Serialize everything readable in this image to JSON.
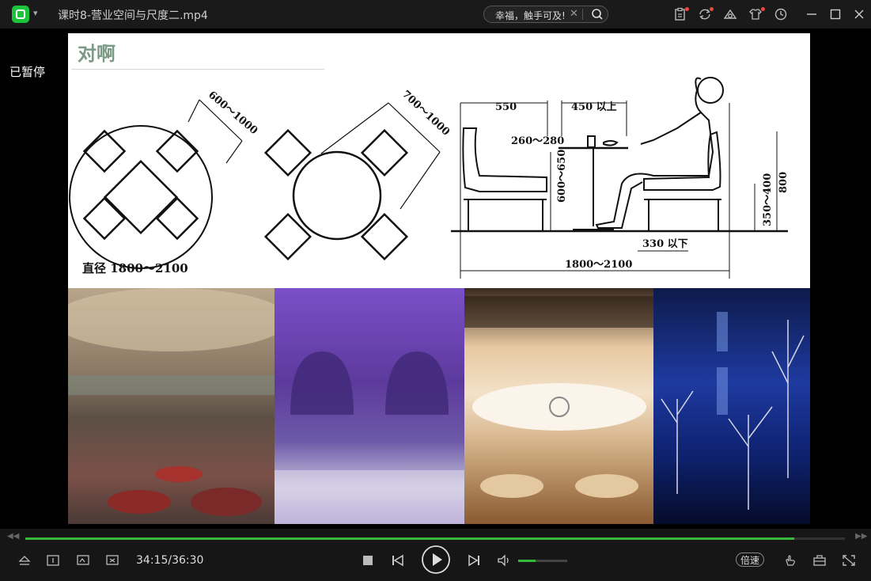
{
  "titlebar": {
    "file_title": "课时8-营业空间与尺度二.mp4",
    "search_query": "幸福，触手可及!",
    "brand_color": "#1bc43a"
  },
  "player": {
    "status_text": "已暂停",
    "current_time": "34:15",
    "total_time": "36:30",
    "time_display": "34:15/36:30",
    "progress": 0.938,
    "volume": 0.35,
    "speed_label": "倍速",
    "accent_color": "#36b83a"
  },
  "slide": {
    "title": "对啊",
    "left_diagram": {
      "dim_top": "600～1000",
      "caption": "直径 1800～2100"
    },
    "mid_diagram": {
      "dim_top": "700～1000"
    },
    "right_diagram": {
      "dim_550": "550",
      "dim_450": "450 以上",
      "dim_260": "260～280",
      "dim_600": "600～650",
      "dim_350": "350～400",
      "dim_800": "800",
      "dim_330": "330 以下",
      "dim_total": "1800～2100"
    }
  }
}
